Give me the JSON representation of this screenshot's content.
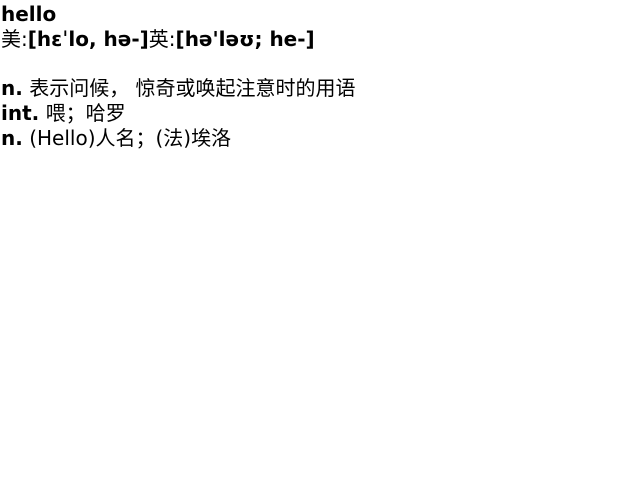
{
  "entry": {
    "word": "hello",
    "phonetics": [
      {
        "label": "美:",
        "ipa": "[hɛˈlo, hə-]"
      },
      {
        "label": "英:",
        "ipa": "[hə'ləʊ; he-]"
      }
    ],
    "definitions": [
      {
        "pos": "n.",
        "text": " 表示问候， 惊奇或唤起注意时的用语"
      },
      {
        "pos": "int.",
        "text": " 喂；哈罗"
      },
      {
        "pos": "n.",
        "text": " (Hello)人名；(法)埃洛"
      }
    ]
  }
}
